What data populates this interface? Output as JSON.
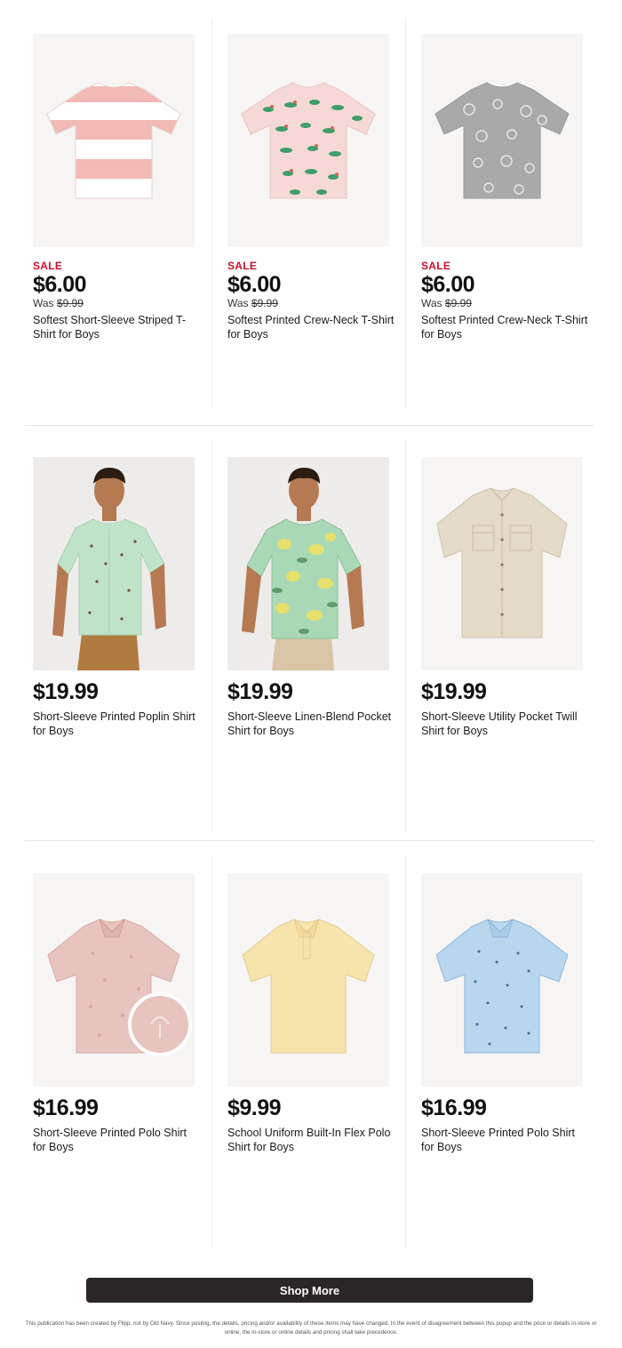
{
  "products": [
    {
      "sale_label": "SALE",
      "price": "$6.00",
      "was_prefix": "Was",
      "was_price": "$9.99",
      "name": "Softest Short-Sleeve Striped T-Shirt for Boys",
      "image_icon": "striped-tshirt-icon",
      "colors": [
        "#f2b9b5",
        "#ffffff"
      ]
    },
    {
      "sale_label": "SALE",
      "price": "$6.00",
      "was_prefix": "Was",
      "was_price": "$9.99",
      "name": "Softest Printed Crew-Neck T-Shirt for Boys",
      "image_icon": "printed-tshirt-icon",
      "colors": [
        "#f6d9d6",
        "#3e9e6a"
      ]
    },
    {
      "sale_label": "SALE",
      "price": "$6.00",
      "was_prefix": "Was",
      "was_price": "$9.99",
      "name": "Softest Printed Crew-Neck T-Shirt for Boys",
      "image_icon": "printed-tshirt-icon",
      "colors": [
        "#a9a9a9",
        "#e8e8e8"
      ]
    },
    {
      "price": "$19.99",
      "name": "Short-Sleeve Printed Poplin Shirt for Boys",
      "image_icon": "boy-model-shirt-icon",
      "colors": [
        "#bfe3c9",
        "#b07b3f"
      ]
    },
    {
      "price": "$19.99",
      "name": "Short-Sleeve Linen-Blend Pocket Shirt for Boys",
      "image_icon": "boy-model-shirt-icon",
      "colors": [
        "#a9d8b7",
        "#e8e06a"
      ]
    },
    {
      "price": "$19.99",
      "name": "Short-Sleeve Utility Pocket Twill Shirt for Boys",
      "image_icon": "button-shirt-icon",
      "colors": [
        "#e3dac8",
        "#d2c6ae"
      ]
    },
    {
      "price": "$16.99",
      "name": "Short-Sleeve Printed Polo Shirt for Boys",
      "image_icon": "polo-shirt-icon",
      "colors": [
        "#e8c4c0",
        "#d6a9a4"
      ]
    },
    {
      "price": "$9.99",
      "name": "School Uniform Built-In Flex Polo Shirt for Boys",
      "image_icon": "polo-shirt-icon",
      "colors": [
        "#f7e3ac",
        "#ecd393"
      ]
    },
    {
      "price": "$16.99",
      "name": "Short-Sleeve Printed Polo Shirt for Boys",
      "image_icon": "polo-shirt-icon",
      "colors": [
        "#b8d6ee",
        "#8fb6d9"
      ]
    }
  ],
  "shop_more": {
    "label": "Shop More"
  },
  "disclaimer": "This publication has been created by Flipp, not by Old Navy. Since posting, the details, pricing and/or availability of these items may have changed. In the event of disagreement between this popup and the price or details in-store or online, the in-store or online details and pricing shall take precedence."
}
